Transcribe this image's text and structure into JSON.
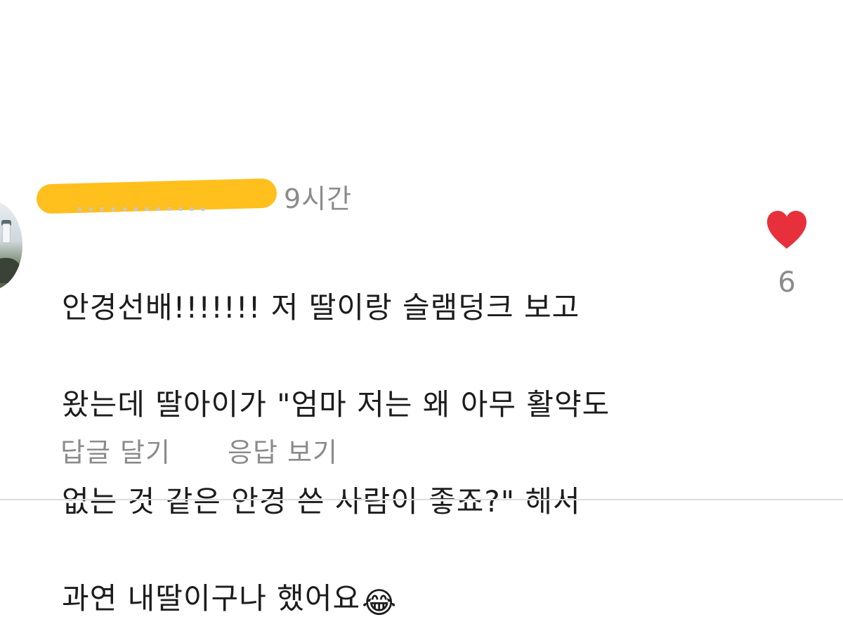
{
  "comment": {
    "time": "9시간",
    "text_lines": [
      "안경선배!!!!!!! 저 딸이랑 슬램덩크 보고",
      "왔는데 딸아이가 \"엄마 저는 왜 아무 활약도",
      "없는 것 같은 안경 쓴 사람이 좋죠?\" 해서",
      "과연 내딸이구나 했어요"
    ],
    "emoji": "😂",
    "like_count": "6",
    "like_color": "#e8303c",
    "username_mask_color": "#ffbf1c",
    "icon_names": {
      "avatar": "profile-photo",
      "like": "heart-icon",
      "emoji": "tears-of-joy-icon"
    },
    "actions": {
      "reply": "답글 달기",
      "view_replies": "응답 보기"
    }
  }
}
